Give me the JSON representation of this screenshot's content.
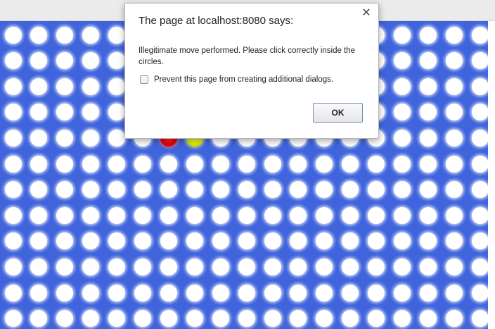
{
  "dialog": {
    "title": "The page at localhost:8080 says:",
    "message": "Illegitimate move performed. Please click correctly inside the circles.",
    "checkbox_label": "Prevent this page from creating additional dialogs.",
    "checkbox_checked": false,
    "ok_label": "OK",
    "close_icon": "close-icon"
  },
  "board": {
    "background_color": "#3f64dc",
    "hole_color": "#ffffff",
    "rows": 12,
    "columns": 19,
    "pieces": [
      {
        "row": 4,
        "column": 6,
        "color": "red"
      },
      {
        "row": 4,
        "column": 7,
        "color": "yellow"
      }
    ]
  }
}
